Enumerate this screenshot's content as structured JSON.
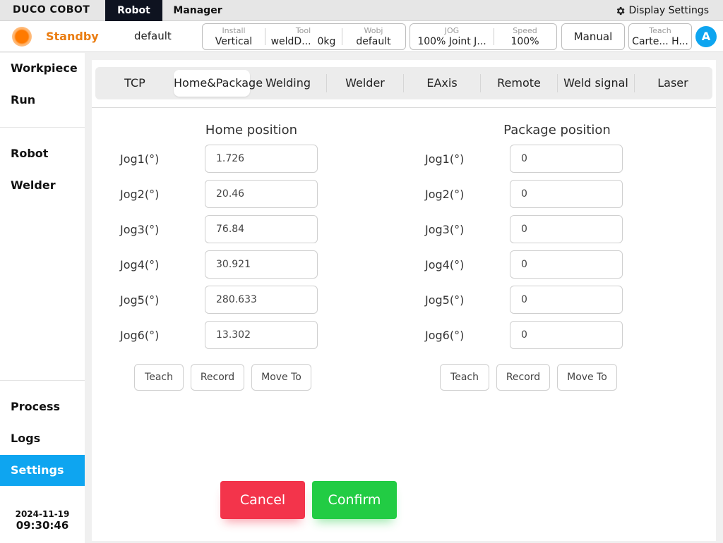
{
  "app": {
    "logo": "DUCO COBOT",
    "menu_tabs": [
      "Robot",
      "Manager"
    ],
    "display_settings": "Display Settings",
    "gear_icon": "gear-icon"
  },
  "status": {
    "state": "Standby",
    "state_color": "#ea7d12",
    "project": "default",
    "install": {
      "label": "Install",
      "value": "Vertical"
    },
    "tool": {
      "label": "Tool",
      "value": "weldD...",
      "weight": "0kg"
    },
    "wobj": {
      "label": "Wobj",
      "value": "default"
    },
    "jog": {
      "label": "JOG",
      "value": "100% Joint J..."
    },
    "speed": {
      "label": "Speed",
      "value": "100%"
    },
    "mode_button": "Manual",
    "teach": {
      "label": "Teach",
      "value": "Carte... H..."
    },
    "avatar_letter": "A",
    "accent": "#0ea5f0"
  },
  "sidebar": {
    "groups": [
      [
        "Workpiece",
        "Run"
      ],
      [
        "Robot",
        "Welder"
      ],
      [
        "Process",
        "Logs",
        "Settings"
      ]
    ],
    "active": "Settings",
    "date": "2024-11-19",
    "time": "09:30:46"
  },
  "tabs": [
    "TCP",
    "Home&Package",
    "Welding",
    "Welder",
    "EAxis",
    "Remote",
    "Weld signal",
    "Laser"
  ],
  "active_tab": "Home&Package",
  "home": {
    "title": "Home position",
    "jogs": [
      {
        "label": "Jog1(°)",
        "value": "1.726"
      },
      {
        "label": "Jog2(°)",
        "value": "20.46"
      },
      {
        "label": "Jog3(°)",
        "value": "76.84"
      },
      {
        "label": "Jog4(°)",
        "value": "30.921"
      },
      {
        "label": "Jog5(°)",
        "value": "280.633"
      },
      {
        "label": "Jog6(°)",
        "value": "13.302"
      }
    ],
    "buttons": [
      "Teach",
      "Record",
      "Move To"
    ]
  },
  "package": {
    "title": "Package position",
    "jogs": [
      {
        "label": "Jog1(°)",
        "value": "0"
      },
      {
        "label": "Jog2(°)",
        "value": "0"
      },
      {
        "label": "Jog3(°)",
        "value": "0"
      },
      {
        "label": "Jog4(°)",
        "value": "0"
      },
      {
        "label": "Jog5(°)",
        "value": "0"
      },
      {
        "label": "Jog6(°)",
        "value": "0"
      }
    ],
    "buttons": [
      "Teach",
      "Record",
      "Move To"
    ]
  },
  "footer": {
    "cancel": "Cancel",
    "confirm": "Confirm",
    "cancel_color": "#f3344b",
    "confirm_color": "#22cc44"
  }
}
